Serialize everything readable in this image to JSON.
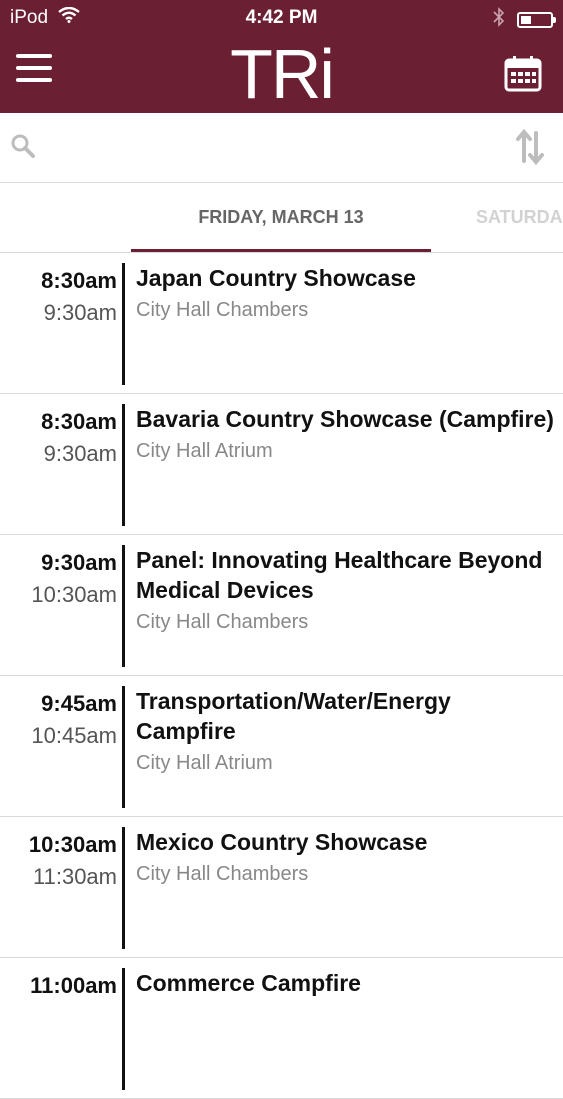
{
  "status_bar": {
    "carrier": "iPod",
    "time": "4:42 PM"
  },
  "nav": {
    "logo": "TRi"
  },
  "search": {
    "value": ""
  },
  "tabs": {
    "active": "FRIDAY, MARCH 13",
    "next": "SATURDA"
  },
  "events": [
    {
      "start": "8:30am",
      "end": "9:30am",
      "title": "Japan Country Showcase",
      "venue": "City Hall Chambers"
    },
    {
      "start": "8:30am",
      "end": "9:30am",
      "title": "Bavaria Country Showcase (Campfire)",
      "venue": "City Hall Atrium"
    },
    {
      "start": "9:30am",
      "end": "10:30am",
      "title": "Panel: Innovating Healthcare Beyond Medical Devices",
      "venue": "City Hall Chambers"
    },
    {
      "start": "9:45am",
      "end": "10:45am",
      "title": "Transportation/Water/Energy Campfire",
      "venue": "City Hall Atrium"
    },
    {
      "start": "10:30am",
      "end": "11:30am",
      "title": "Mexico Country Showcase",
      "venue": "City Hall Chambers"
    },
    {
      "start": "11:00am",
      "end": "",
      "title": "Commerce Campfire",
      "venue": ""
    }
  ],
  "colors": {
    "brand": "#6b1f33",
    "divider": "#d9d9d9"
  }
}
